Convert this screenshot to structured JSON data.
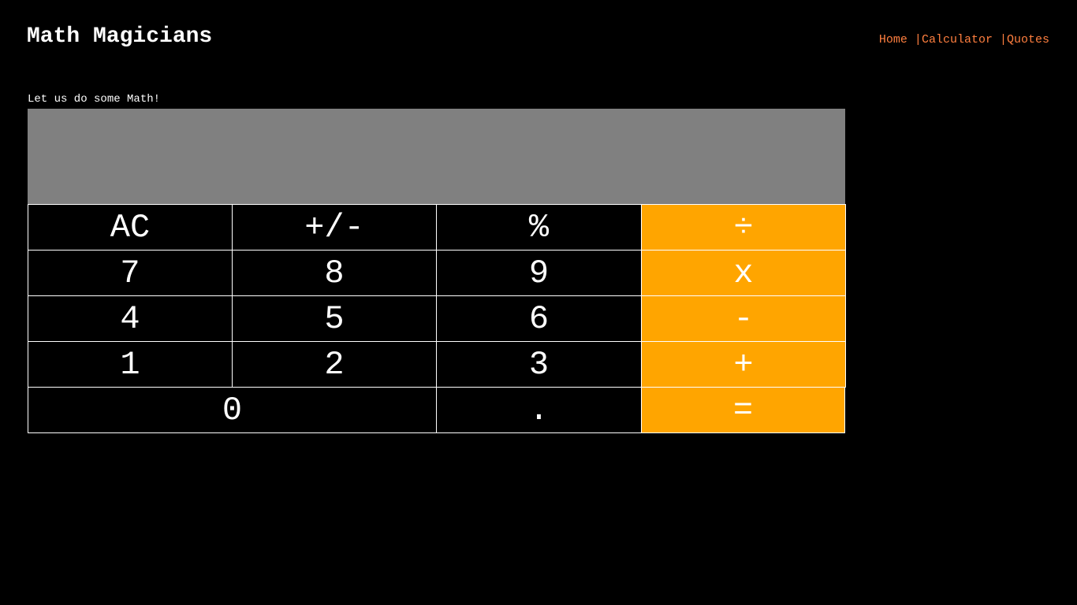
{
  "header": {
    "title": "Math Magicians",
    "nav": {
      "home": "Home",
      "calculator": "Calculator",
      "quotes": "Quotes",
      "separator": "|"
    }
  },
  "main": {
    "subtitle": "Let us do some Math!"
  },
  "calculator": {
    "display_value": "",
    "keys": {
      "ac": "AC",
      "sign": "+/-",
      "percent": "%",
      "divide": "÷",
      "seven": "7",
      "eight": "8",
      "nine": "9",
      "multiply": "x",
      "four": "4",
      "five": "5",
      "six": "6",
      "subtract": "-",
      "one": "1",
      "two": "2",
      "three": "3",
      "add": "+",
      "zero": "0",
      "decimal": ".",
      "equals": "="
    }
  },
  "colors": {
    "background": "#000000",
    "display": "#808080",
    "operator": "#ffa500",
    "nav_link": "#ff7f3f",
    "text": "#ffffff"
  }
}
